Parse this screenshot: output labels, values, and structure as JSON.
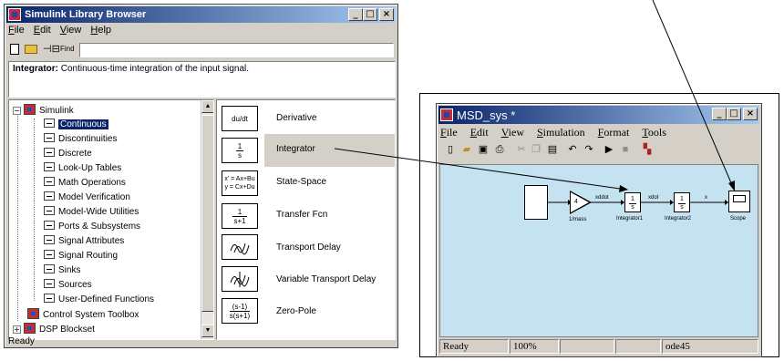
{
  "library": {
    "title": "Simulink Library Browser",
    "menu": [
      "File",
      "Edit",
      "View",
      "Help"
    ],
    "find_label": "Find",
    "description_bold": "Integrator:",
    "description": " Continuous-time integration of the input signal.",
    "tree": {
      "root": "Simulink",
      "items": [
        "Continuous",
        "Discontinuities",
        "Discrete",
        "Look-Up Tables",
        "Math Operations",
        "Model Verification",
        "Model-Wide Utilities",
        "Ports & Subsystems",
        "Signal Attributes",
        "Signal Routing",
        "Sinks",
        "Sources",
        "User-Defined Functions"
      ],
      "extra": [
        "Control System Toolbox",
        "DSP Blockset"
      ]
    },
    "blocks": [
      {
        "name": "Derivative",
        "icon": "du/dt"
      },
      {
        "name": "Integrator",
        "icon_num": "1",
        "icon_den": "s"
      },
      {
        "name": "State-Space",
        "icon_l1": "x' = Ax+Bu",
        "icon_l2": "y = Cx+Du"
      },
      {
        "name": "Transfer Fcn",
        "icon_num": "1",
        "icon_den": "s+1"
      },
      {
        "name": "Transport Delay",
        "icon": "transport-delay-icon"
      },
      {
        "name": "Variable Transport Delay",
        "icon": "variable-transport-delay-icon"
      },
      {
        "name": "Zero-Pole",
        "icon_num": "(s-1)",
        "icon_den": "s(s+1)"
      }
    ],
    "status": "Ready"
  },
  "model": {
    "title": "MSD_sys *",
    "menu": [
      "File",
      "Edit",
      "View",
      "Simulation",
      "Format",
      "Tools"
    ],
    "blocks": {
      "gain_value": "4",
      "gain_label": "1/mass",
      "int1_num": "1",
      "int1_den": "s",
      "int1_label": "Integrator1",
      "int2_num": "1",
      "int2_den": "s",
      "int2_label": "Integrator2",
      "scope_label": "Scope"
    },
    "signals": {
      "s1": "xddot",
      "s2": "xdot",
      "s3": "x"
    },
    "status": {
      "ready": "Ready",
      "zoom": "100%",
      "solver": "ode45"
    }
  }
}
